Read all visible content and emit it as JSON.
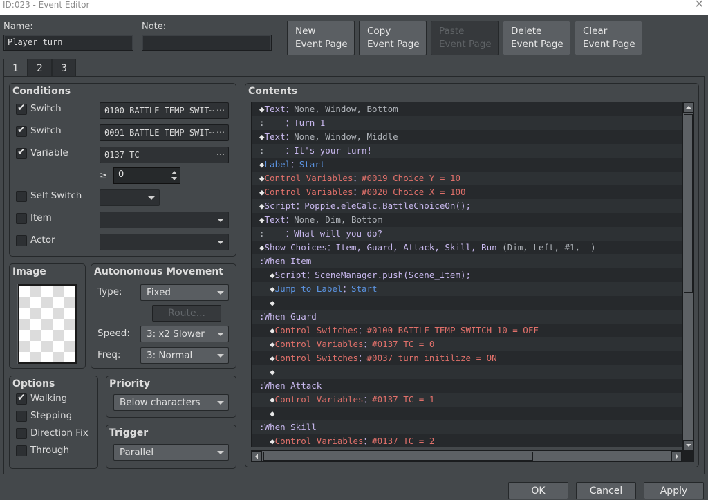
{
  "window": {
    "title": "ID:023 - Event Editor",
    "close_icon": "close-icon"
  },
  "header": {
    "name_label": "Name:",
    "name_value": "Player turn",
    "note_label": "Note:",
    "note_value": "",
    "buttons": [
      {
        "line1": "New",
        "line2": "Event Page",
        "enabled": true
      },
      {
        "line1": "Copy",
        "line2": "Event Page",
        "enabled": true
      },
      {
        "line1": "Paste",
        "line2": "Event Page",
        "enabled": false
      },
      {
        "line1": "Delete",
        "line2": "Event Page",
        "enabled": true
      },
      {
        "line1": "Clear",
        "line2": "Event Page",
        "enabled": true
      }
    ]
  },
  "tabs": [
    {
      "label": "1",
      "active": true
    },
    {
      "label": "2",
      "active": false
    },
    {
      "label": "3",
      "active": false
    }
  ],
  "conditions": {
    "title": "Conditions",
    "switch1": {
      "label": "Switch",
      "checked": true,
      "value": "0100 BATTLE TEMP SWIT⋯",
      "button": "⋯"
    },
    "switch2": {
      "label": "Switch",
      "checked": true,
      "value": "0091 BATTLE TEMP SWIT⋯",
      "button": "⋯"
    },
    "variable": {
      "label": "Variable",
      "checked": true,
      "value": "0137 TC",
      "button": "⋯",
      "operator": "≥",
      "amount": "0"
    },
    "self_switch": {
      "label": "Self Switch",
      "checked": false,
      "value": ""
    },
    "item": {
      "label": "Item",
      "checked": false,
      "value": ""
    },
    "actor": {
      "label": "Actor",
      "checked": false,
      "value": ""
    }
  },
  "image": {
    "title": "Image"
  },
  "autonomous": {
    "title": "Autonomous Movement",
    "type_label": "Type:",
    "type_value": "Fixed",
    "route_button": "Route...",
    "speed_label": "Speed:",
    "speed_value": "3: x2 Slower",
    "freq_label": "Freq:",
    "freq_value": "3: Normal"
  },
  "options": {
    "title": "Options",
    "items": [
      {
        "label": "Walking",
        "checked": true
      },
      {
        "label": "Stepping",
        "checked": false
      },
      {
        "label": "Direction Fix",
        "checked": false
      },
      {
        "label": "Through",
        "checked": false
      }
    ]
  },
  "priority": {
    "title": "Priority",
    "value": "Below characters"
  },
  "trigger": {
    "title": "Trigger",
    "value": "Parallel"
  },
  "contents": {
    "title": "Contents",
    "rows": [
      {
        "indent": 0,
        "diamond": true,
        "cmd": "Text",
        "cls": "c-cmd",
        "args": "None, Window, Bottom",
        "argcls": "c-arg"
      },
      {
        "indent": 0,
        "diamond": false,
        "prefix": ":",
        "cmd": "    ",
        "cls": "c-cmd",
        "args": "Turn 1",
        "argcls": "c-txt"
      },
      {
        "indent": 0,
        "diamond": true,
        "cmd": "Text",
        "cls": "c-cmd",
        "args": "None, Window, Middle",
        "argcls": "c-arg"
      },
      {
        "indent": 0,
        "diamond": false,
        "prefix": ":",
        "cmd": "    ",
        "cls": "c-cmd",
        "args": "It's your turn!",
        "argcls": "c-txt"
      },
      {
        "indent": 0,
        "diamond": true,
        "cmd": "Label",
        "cls": "c-blue",
        "args": "Start",
        "argcls": "c-blue"
      },
      {
        "indent": 0,
        "diamond": true,
        "cmd": "Control Variables",
        "cls": "c-red",
        "args": "#0019 Choice Y = 10",
        "argcls": "c-red"
      },
      {
        "indent": 0,
        "diamond": true,
        "cmd": "Control Variables",
        "cls": "c-red",
        "args": "#0020 Choice X = 100",
        "argcls": "c-red"
      },
      {
        "indent": 0,
        "diamond": true,
        "cmd": "Script",
        "cls": "c-cmd",
        "args": "Poppie.eleCalc.BattleChoiceOn();",
        "argcls": "c-txt"
      },
      {
        "indent": 0,
        "diamond": true,
        "cmd": "Text",
        "cls": "c-cmd",
        "args": "None, Dim, Bottom",
        "argcls": "c-arg"
      },
      {
        "indent": 0,
        "diamond": false,
        "prefix": ":",
        "cmd": "    ",
        "cls": "c-cmd",
        "args": "What will you do?",
        "argcls": "c-txt"
      },
      {
        "indent": 0,
        "diamond": true,
        "cmd": "Show Choices",
        "cls": "c-cmd",
        "args": "Item, Guard, Attack, Skill, Run",
        "argcls": "c-txt",
        "extra": " (Dim, Left, #1, -)"
      },
      {
        "indent": 0,
        "diamond": false,
        "branch": "When Item"
      },
      {
        "indent": 1,
        "diamond": true,
        "cmd": "Script",
        "cls": "c-cmd",
        "args": "SceneManager.push(Scene_Item);",
        "argcls": "c-txt"
      },
      {
        "indent": 1,
        "diamond": true,
        "cmd": "Jump to Label",
        "cls": "c-blue",
        "args": "Start",
        "argcls": "c-blue"
      },
      {
        "indent": 1,
        "diamond": true,
        "cmd": "",
        "cls": "c-cmd",
        "args": "",
        "argcls": "c-txt",
        "empty": true
      },
      {
        "indent": 0,
        "diamond": false,
        "branch": "When Guard"
      },
      {
        "indent": 1,
        "diamond": true,
        "cmd": "Control Switches",
        "cls": "c-red",
        "args": "#0100 BATTLE TEMP SWITCH 10 = OFF",
        "argcls": "c-red"
      },
      {
        "indent": 1,
        "diamond": true,
        "cmd": "Control Variables",
        "cls": "c-red",
        "args": "#0137 TC = 0",
        "argcls": "c-red"
      },
      {
        "indent": 1,
        "diamond": true,
        "cmd": "Control Switches",
        "cls": "c-red",
        "args": "#0037 turn initilize = ON",
        "argcls": "c-red"
      },
      {
        "indent": 1,
        "diamond": true,
        "cmd": "",
        "cls": "c-cmd",
        "args": "",
        "argcls": "c-txt",
        "empty": true
      },
      {
        "indent": 0,
        "diamond": false,
        "branch": "When Attack"
      },
      {
        "indent": 1,
        "diamond": true,
        "cmd": "Control Variables",
        "cls": "c-red",
        "args": "#0137 TC = 1",
        "argcls": "c-red"
      },
      {
        "indent": 1,
        "diamond": true,
        "cmd": "",
        "cls": "c-cmd",
        "args": "",
        "argcls": "c-txt",
        "empty": true
      },
      {
        "indent": 0,
        "diamond": false,
        "branch": "When Skill"
      },
      {
        "indent": 1,
        "diamond": true,
        "cmd": "Control Variables",
        "cls": "c-red",
        "args": "#0137 TC = 2",
        "argcls": "c-red"
      }
    ]
  },
  "footer": {
    "ok": "OK",
    "cancel": "Cancel",
    "apply": "Apply"
  }
}
